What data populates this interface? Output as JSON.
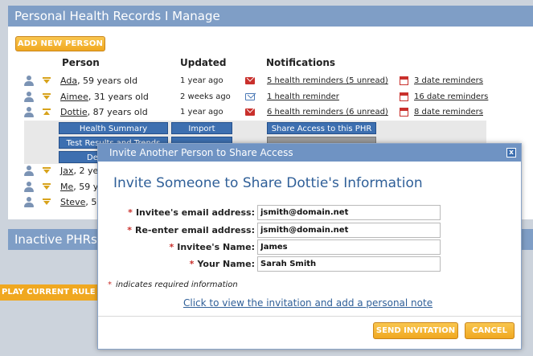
{
  "page": {
    "title": "Personal Health Records I Manage",
    "add_button": "ADD NEW PERSON",
    "columns": {
      "person": "Person",
      "updated": "Updated",
      "notifications": "Notifications"
    },
    "people": [
      {
        "name": "Ada",
        "age": ", 59 years old",
        "updated": "1 year ago",
        "mail": "unread",
        "notifications": "5 health reminders (5 unread)",
        "date_reminders": "3 date reminders",
        "arrow": "down"
      },
      {
        "name": "Aimee",
        "age": ", 31 years old",
        "updated": "2 weeks ago",
        "mail": "read",
        "notifications": "1 health reminder",
        "date_reminders": "16 date reminders",
        "arrow": "down"
      },
      {
        "name": "Dottie",
        "age": ", 87 years old",
        "updated": "1 year ago",
        "mail": "unread",
        "notifications": "6 health reminders (6 unread)",
        "date_reminders": "8 date reminders",
        "arrow": "up"
      },
      {
        "name": "Jax",
        "age": ", 2 ye",
        "arrow": "down"
      },
      {
        "name": "Me",
        "age": ", 59 ye",
        "arrow": "down"
      },
      {
        "name": "Steve",
        "age": ", 55",
        "arrow": "down"
      }
    ],
    "expand_buttons": {
      "health_summary": "Health Summary",
      "import": "Import",
      "share_access": "Share Access to this PHR",
      "test_results": "Test Results and Trends",
      "de": "De"
    },
    "inactive_title": "Inactive PHRs I M",
    "rule_bar": "PLAY CURRENT RULE VAL"
  },
  "dialog": {
    "title": "Invite Another Person to Share Access",
    "close": "x",
    "heading": "Invite Someone to Share Dottie's Information",
    "fields": [
      {
        "label": "Invitee's email address:",
        "value": "jsmith@domain.net"
      },
      {
        "label": "Re-enter email address:",
        "value": "jsmith@domain.net"
      },
      {
        "label": "Invitee's Name:",
        "value": "James"
      },
      {
        "label": "Your Name:",
        "value": "Sarah Smith"
      }
    ],
    "required_star": "*",
    "required_note": "indicates required information",
    "invite_link": "Click to view the invitation and add a personal note",
    "send_button": "SEND INVITATION",
    "cancel_button": "CANCEL"
  },
  "colors": {
    "header_blue": "#7f9ec6",
    "link_blue": "#2f5f98",
    "orange": "#f0a820",
    "required_red": "#c9302c"
  }
}
